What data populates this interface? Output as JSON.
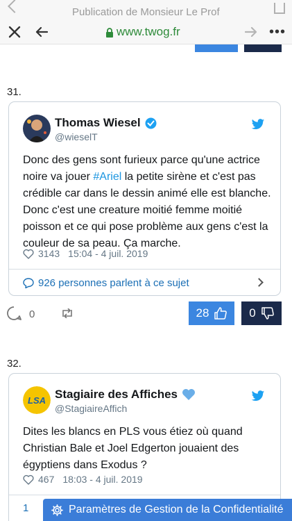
{
  "browser": {
    "page_title": "Publication de Monsieur Le Prof",
    "url": "www.twog.fr",
    "more_label": "•••"
  },
  "posts": [
    {
      "number": "31.",
      "tweet": {
        "name": "Thomas Wiesel",
        "handle": "@wieselT",
        "verified": true,
        "text_before": "Donc des gens sont furieux parce qu'une actrice noire va jouer ",
        "hashtag": "#Ariel",
        "text_after": " la petite sirène et c'est pas crédible car dans le dessin animé elle est blanche. Donc c'est une creature moitié femme moitié poisson et ce qui pose problème aux gens c'est la couleur de sa peau. Ça marche.",
        "likes": "3143",
        "timestamp": "15:04 - 4 juil. 2019",
        "footer": "926 personnes parlent à ce sujet"
      },
      "comments": "0",
      "like_count": "28",
      "dislike_count": "0"
    },
    {
      "number": "32.",
      "tweet": {
        "name": "Stagiaire des Affiches",
        "handle": "@StagiaireAffich",
        "avatar_text": "LSA",
        "text": "Dites les blancs en PLS vous étiez où quand Christian Bale et Joel Edgerton jouaient des égyptiens dans Exodus ?",
        "likes": "467",
        "timestamp": "18:03 - 4 juil. 2019",
        "footer_partial": "1"
      }
    }
  ],
  "privacy_bar": {
    "label": "Paramètres de Gestion de la Confidentialité"
  },
  "colors": {
    "accent": "#3b86e0",
    "dark": "#1b2a4a",
    "link": "#1b95e0",
    "url_green": "#2e8b3a"
  }
}
